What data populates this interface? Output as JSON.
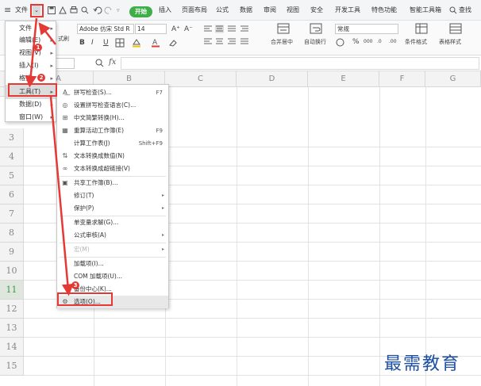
{
  "menubar": {
    "file_label": "文件",
    "tabs": [
      "开始",
      "插入",
      "页面布局",
      "公式",
      "数据",
      "审阅",
      "视图",
      "安全",
      "开发工具",
      "特色功能",
      "智能工具箱"
    ],
    "search_label": "查找"
  },
  "ribbon": {
    "paste_label": "式刷",
    "font_name": "Adobe 仿宋 Std R",
    "font_size": "14",
    "font_grow": "A⁺",
    "font_shrink": "A⁻",
    "bold": "B",
    "italic": "I",
    "underline": "U",
    "merge_label": "合并居中",
    "wrap_label": "自动换行",
    "number_format": "常规",
    "percent": "%",
    "cond_format_label": "条件格式",
    "table_style_label": "表格样式"
  },
  "formula": {
    "fx": "fx"
  },
  "grid": {
    "columns": [
      "A",
      "B",
      "C",
      "D",
      "E",
      "F",
      "G"
    ],
    "rows": [
      "3",
      "4",
      "5",
      "6",
      "7",
      "8",
      "9",
      "10",
      "11",
      "12",
      "13",
      "14",
      "15"
    ],
    "selected_row": "11"
  },
  "file_menu": {
    "items": [
      {
        "label": "文件",
        "arrow": "▸"
      },
      {
        "label": "编辑(E)",
        "arrow": "▸"
      },
      {
        "label": "视图(V)",
        "arrow": "▸"
      },
      {
        "label": "插入(I)",
        "arrow": "▸"
      },
      {
        "label": "格式",
        "arrow": "▸"
      },
      {
        "label": "工具(T)",
        "arrow": "▸"
      },
      {
        "label": "数据(D)",
        "arrow": "▸"
      },
      {
        "label": "窗口(W)",
        "arrow": "▸"
      }
    ]
  },
  "tools_menu": {
    "items": [
      {
        "label": "拼写检查(S)...",
        "shortcut": "F7"
      },
      {
        "label": "设置拼写检查语言(C)..."
      },
      {
        "label": "中文简繁转换(H)..."
      },
      {
        "label": "重算活动工作簿(E)",
        "shortcut": "F9"
      },
      {
        "label": "计算工作表(J)",
        "shortcut": "Shift+F9"
      },
      {
        "label": "文本转换成数值(N)"
      },
      {
        "label": "文本转换成超链接(V)"
      },
      {
        "label": "共享工作簿(B)..."
      },
      {
        "label": "修订(T)",
        "arrow": "▸"
      },
      {
        "label": "保护(P)",
        "arrow": "▸"
      },
      {
        "label": "单变量求解(G)..."
      },
      {
        "label": "公式审核(A)",
        "arrow": "▸"
      },
      {
        "label": "宏(M)",
        "arrow": "▸"
      },
      {
        "label": "加载项(I)..."
      },
      {
        "label": "COM 加载项(U)..."
      },
      {
        "label": "备份中心(K)..."
      },
      {
        "label": "选项(O)..."
      }
    ]
  },
  "annotations": {
    "badges": [
      "1",
      "2",
      "3"
    ]
  },
  "colors": {
    "accent": "#3fae49",
    "annotation": "#e53935",
    "watermark": "#1d4fa3"
  },
  "watermark": "最需教育"
}
